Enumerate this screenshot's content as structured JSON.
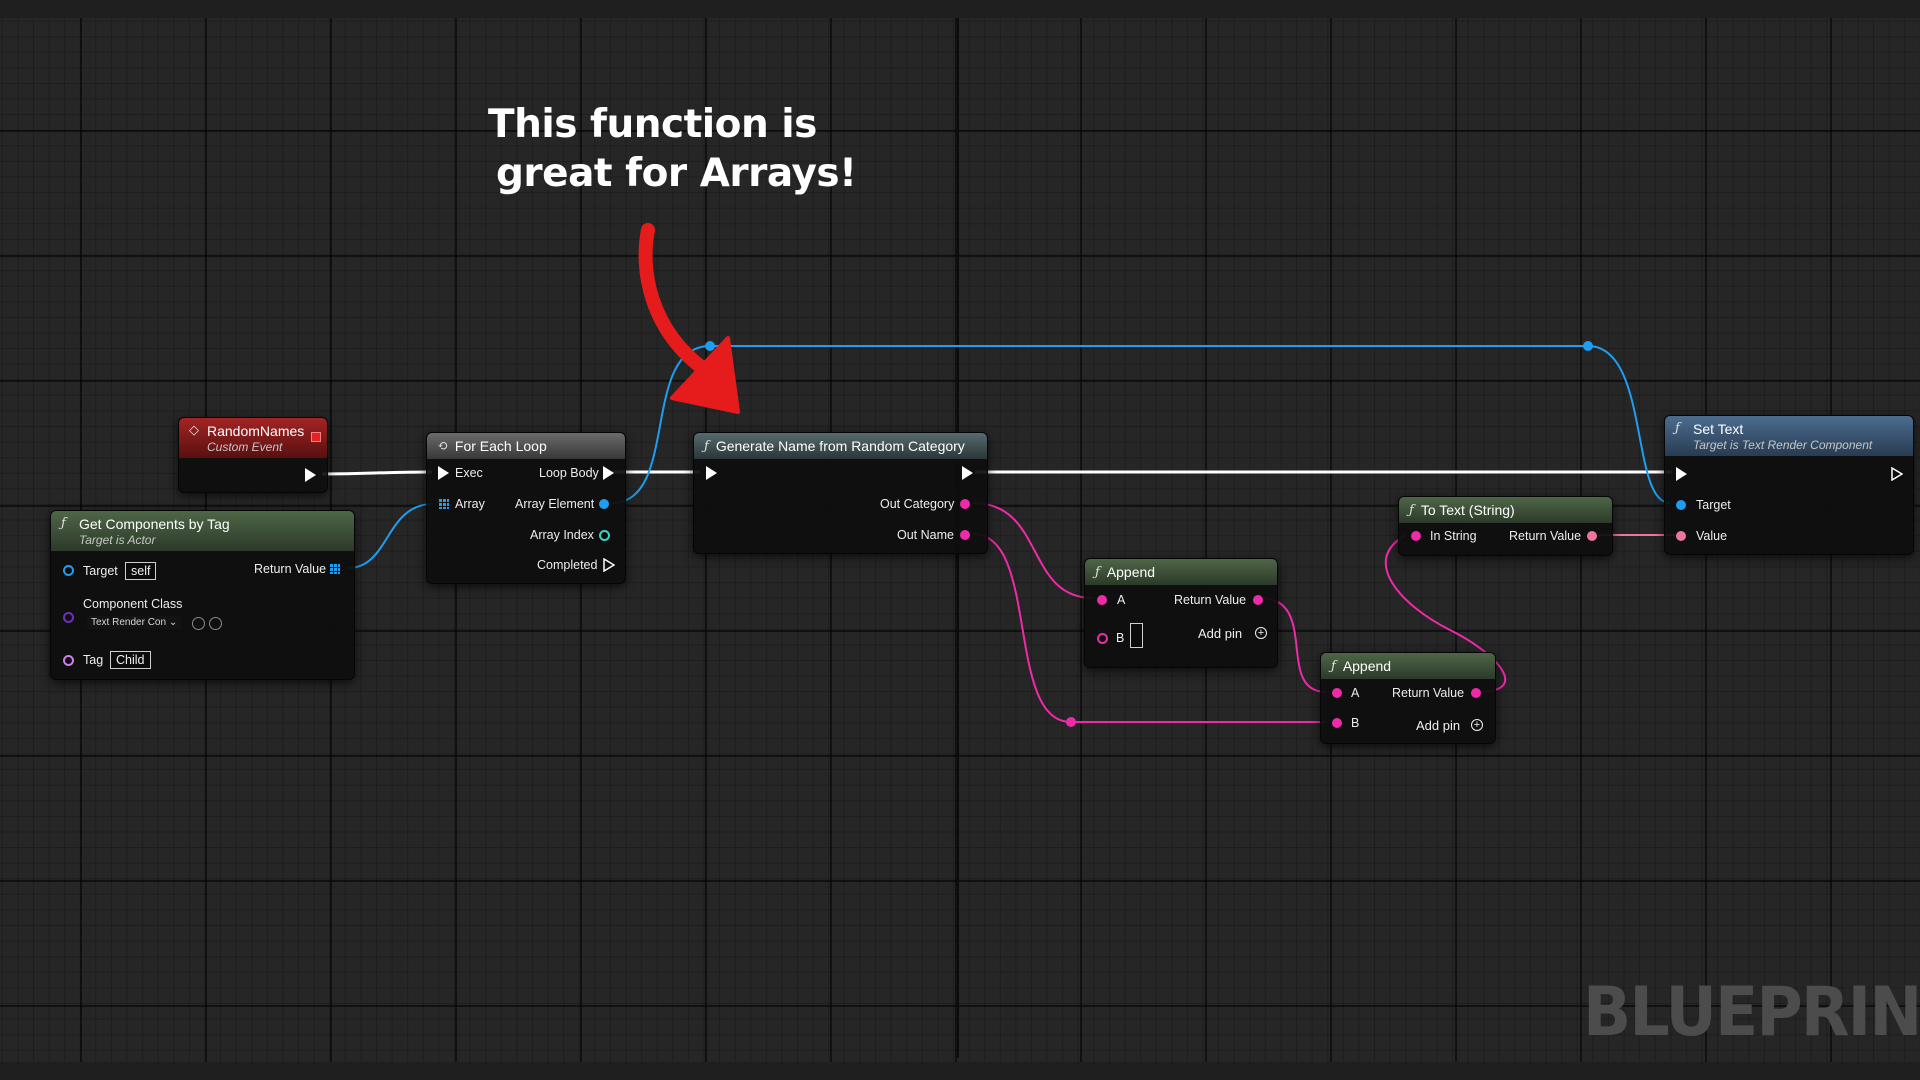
{
  "annotation": {
    "line1": "This function is",
    "line2": "great for Arrays!"
  },
  "watermark": "BLUEPRINT",
  "nodes": {
    "random_names": {
      "title": "RandomNames",
      "subtitle": "Custom Event"
    },
    "get_components": {
      "title": "Get Components by Tag",
      "subtitle": "Target is Actor",
      "target_label": "Target",
      "target_value": "self",
      "return_label": "Return Value",
      "component_class_label": "Component Class",
      "component_class_value": "Text Render Con",
      "tag_label": "Tag",
      "tag_value": "Child"
    },
    "for_each": {
      "title": "For Each Loop",
      "exec_label": "Exec",
      "loop_body_label": "Loop Body",
      "array_label": "Array",
      "array_element_label": "Array Element",
      "array_index_label": "Array Index",
      "completed_label": "Completed"
    },
    "generate_name": {
      "title": "Generate Name from Random Category",
      "out_category_label": "Out Category",
      "out_name_label": "Out Name"
    },
    "append1": {
      "title": "Append",
      "a_label": "A",
      "b_label": "B",
      "return_label": "Return Value",
      "add_pin_label": "Add pin"
    },
    "append2": {
      "title": "Append",
      "a_label": "A",
      "b_label": "B",
      "return_label": "Return Value",
      "add_pin_label": "Add pin"
    },
    "to_text": {
      "title": "To Text (String)",
      "in_label": "In String",
      "return_label": "Return Value"
    },
    "set_text": {
      "title": "Set Text",
      "subtitle": "Target is Text Render Component",
      "target_label": "Target",
      "value_label": "Value"
    }
  },
  "colors": {
    "exec_wire": "#ffffff",
    "object_wire": "#1e9df2",
    "string_wire": "#ef2aa8",
    "text_wire": "#f0759c",
    "arrow": "#e61c1c",
    "background": "#262626"
  },
  "icons": [
    "function-icon",
    "loop-icon",
    "event-diamond-icon",
    "array-grid-icon",
    "add-pin-icon",
    "browse-icon",
    "search-icon",
    "chevron-down-icon"
  ]
}
